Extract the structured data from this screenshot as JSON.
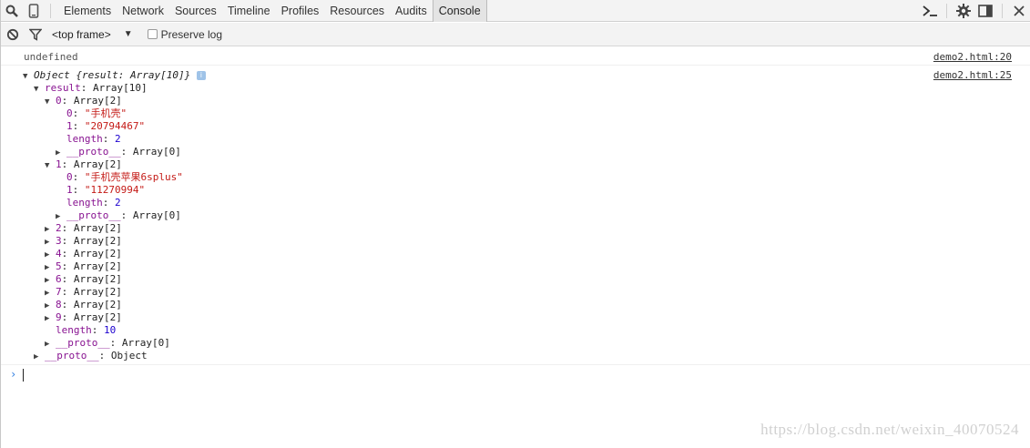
{
  "toolbar": {
    "tabs": [
      "Elements",
      "Network",
      "Sources",
      "Timeline",
      "Profiles",
      "Resources",
      "Audits",
      "Console"
    ],
    "active_tab": "Console"
  },
  "console_toolbar": {
    "frame": "<top frame>",
    "frame_arrow": "▼",
    "preserve_log": "Preserve log"
  },
  "log": {
    "first": {
      "text": "undefined",
      "source": "demo2.html:20"
    },
    "second_source": "demo2.html:25",
    "object_label": "Object",
    "object_preview": "{result: Array[10]}",
    "result_key": "result",
    "result_value": "Array[10]",
    "arrays": [
      {
        "key": "0",
        "value": "Array[2]",
        "expanded": true,
        "items": [
          {
            "k": "0",
            "v": "\"手机壳\""
          },
          {
            "k": "1",
            "v": "\"20794467\""
          }
        ],
        "length": "2"
      },
      {
        "key": "1",
        "value": "Array[2]",
        "expanded": true,
        "items": [
          {
            "k": "0",
            "v": "\"手机壳苹果6splus\""
          },
          {
            "k": "1",
            "v": "\"11270994\""
          }
        ],
        "length": "2"
      },
      {
        "key": "2",
        "value": "Array[2]"
      },
      {
        "key": "3",
        "value": "Array[2]"
      },
      {
        "key": "4",
        "value": "Array[2]"
      },
      {
        "key": "5",
        "value": "Array[2]"
      },
      {
        "key": "6",
        "value": "Array[2]"
      },
      {
        "key": "7",
        "value": "Array[2]"
      },
      {
        "key": "8",
        "value": "Array[2]"
      },
      {
        "key": "9",
        "value": "Array[2]"
      }
    ],
    "length_key": "length",
    "result_length": "10",
    "proto_key": "__proto__",
    "array_proto": "Array[0]",
    "object_proto": "Object"
  },
  "watermark": "https://blog.csdn.net/weixin_40070524"
}
